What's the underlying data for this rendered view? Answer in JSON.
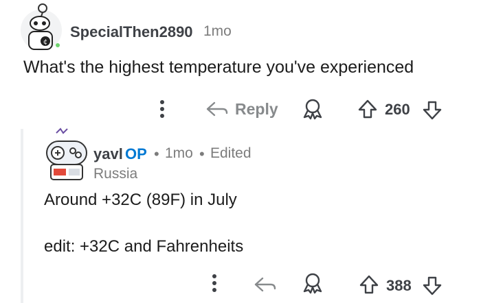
{
  "comment": {
    "username": "SpecialThen2890",
    "age": "1mo",
    "body": "What's the highest temperature you've experienced",
    "actions": {
      "reply_label": "Reply",
      "votes": "260"
    }
  },
  "reply": {
    "username": "yavl",
    "op_badge": "OP",
    "age": "1mo",
    "edited": "Edited",
    "flair": "Russia",
    "body_line1": "Around +32C (89F) in July",
    "body_line2": "edit: +32C and Fahrenheits",
    "actions": {
      "votes": "388"
    }
  },
  "colors": {
    "icon_gray": "#878a8c",
    "op_blue": "#0079d3",
    "thread_line": "#edeff1"
  }
}
